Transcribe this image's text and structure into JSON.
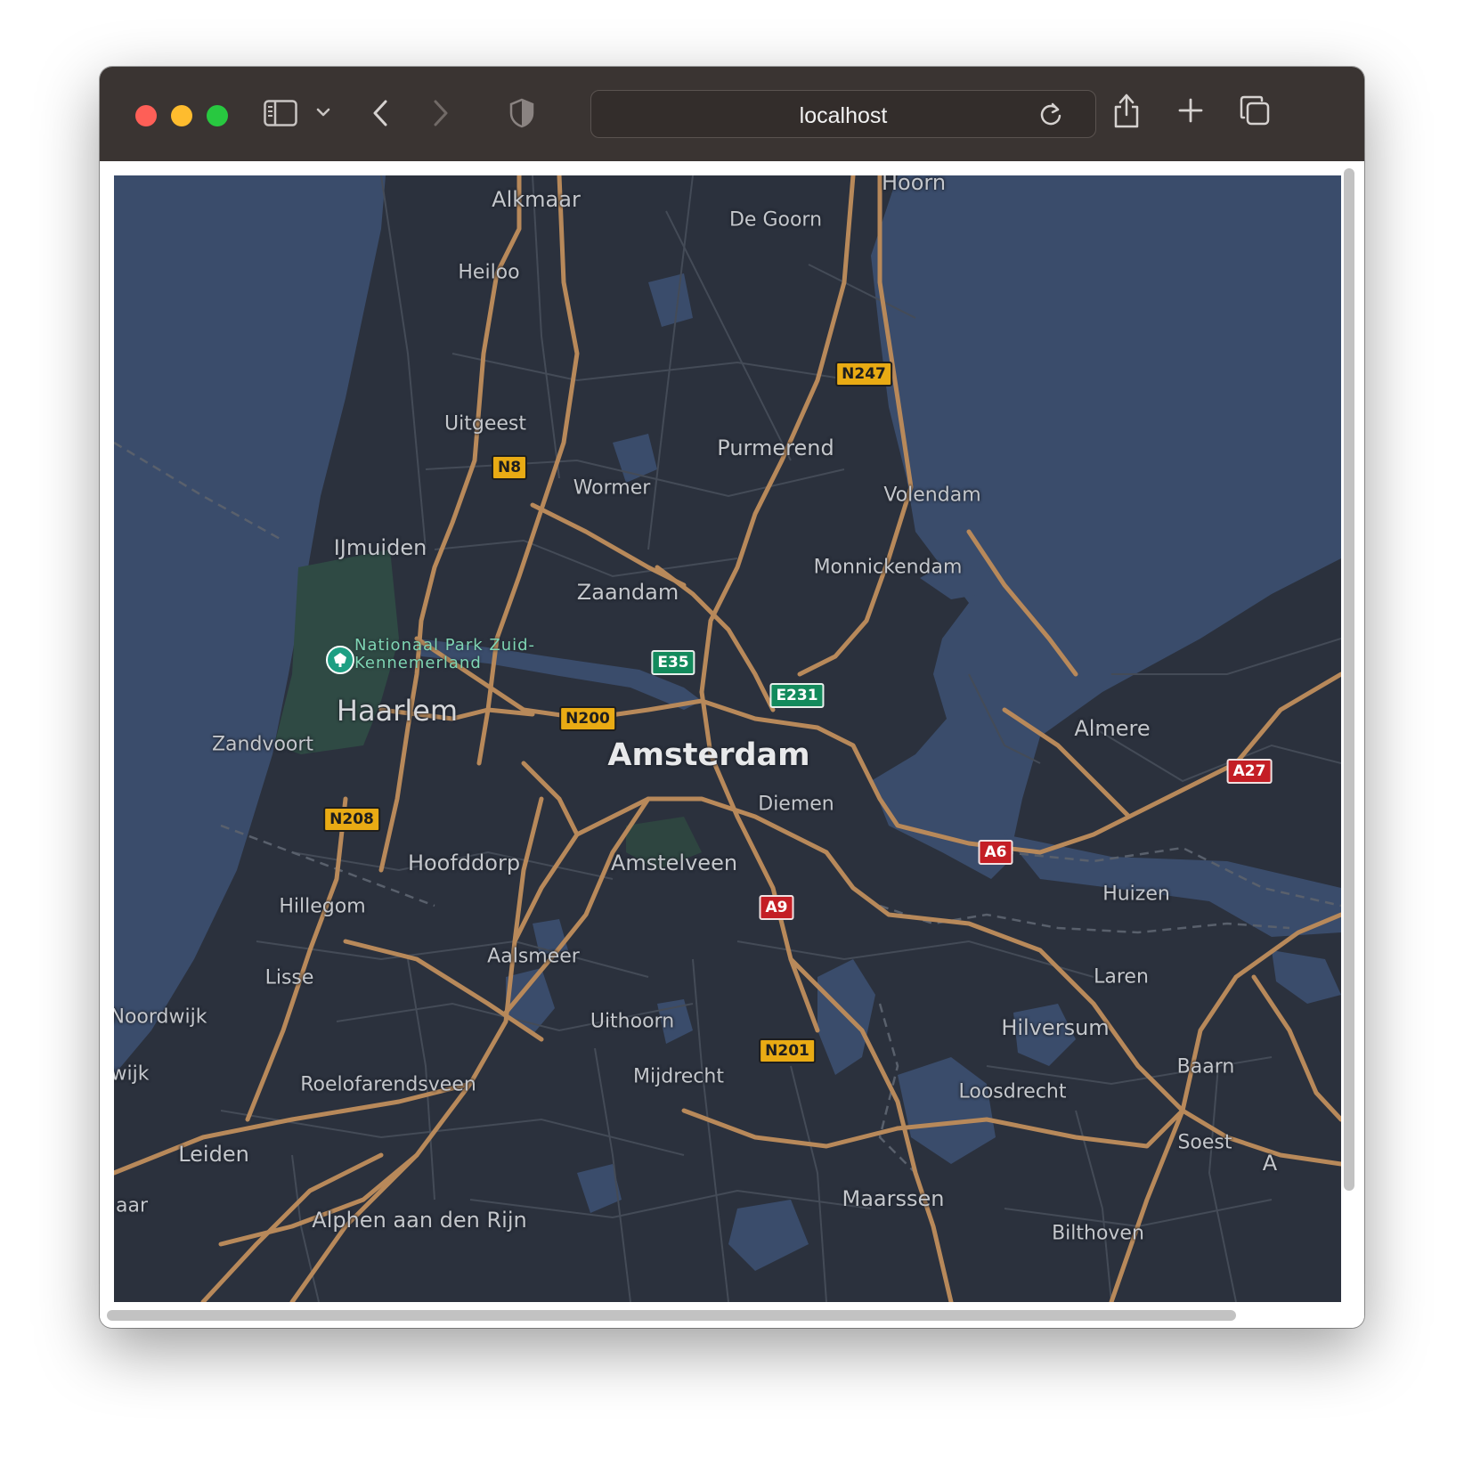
{
  "browser": {
    "address": "localhost",
    "icons": {
      "sidebar": "sidebar-icon",
      "dropdown": "chevron-down-icon",
      "back": "chevron-left-icon",
      "forward": "chevron-right-icon",
      "privacy": "shield-icon",
      "reload": "reload-icon",
      "share": "share-icon",
      "new_tab": "plus-icon",
      "tabs": "tab-overview-icon"
    }
  },
  "map": {
    "theme": {
      "land": "#2b313d",
      "water": "#3a4c6b",
      "roads": "#b8895a",
      "minor_roads": "#444b57",
      "park": "#2f4a44"
    },
    "places": {
      "alkmaar": "Alkmaar",
      "hoorn": "Hoorn",
      "de_goorn": "De Goorn",
      "heiloo": "Heiloo",
      "uitgeest": "Uitgeest",
      "purmerend": "Purmerend",
      "wormer": "Wormer",
      "volendam": "Volendam",
      "ijmuiden": "IJmuiden",
      "monnickendam": "Monnickendam",
      "zaandam": "Zaandam",
      "haarlem": "Haarlem",
      "zandvoort": "Zandvoort",
      "amsterdam": "Amsterdam",
      "almere": "Almere",
      "diemen": "Diemen",
      "hoofddorp": "Hoofddorp",
      "amstelveen": "Amstelveen",
      "hillegom": "Hillegom",
      "huizen": "Huizen",
      "aalsmeer": "Aalsmeer",
      "lisse": "Lisse",
      "laren": "Laren",
      "noordwijk": "Noordwijk",
      "uithoorn": "Uithoorn",
      "hilversum": "Hilversum",
      "wijk": "wijk",
      "mijdrecht": "Mijdrecht",
      "baarn": "Baarn",
      "roelofarendsveen": "Roelofarendsveen",
      "loosdrecht": "Loosdrecht",
      "leiden": "Leiden",
      "soest": "Soest",
      "a_edge": "A",
      "aar": "aar",
      "maarssen": "Maarssen",
      "alphen": "Alphen aan den Rijn",
      "bilthoven": "Bilthoven"
    },
    "park": {
      "line1": "Nationaal Park Zuid-",
      "line2": "Kennemerland",
      "icon": "park-icon"
    },
    "shields": {
      "n247": "N247",
      "n8": "N8",
      "e35": "E35",
      "e231": "E231",
      "n200": "N200",
      "n208": "N208",
      "a27": "A27",
      "a6": "A6",
      "a9": "A9",
      "n201": "N201"
    }
  }
}
